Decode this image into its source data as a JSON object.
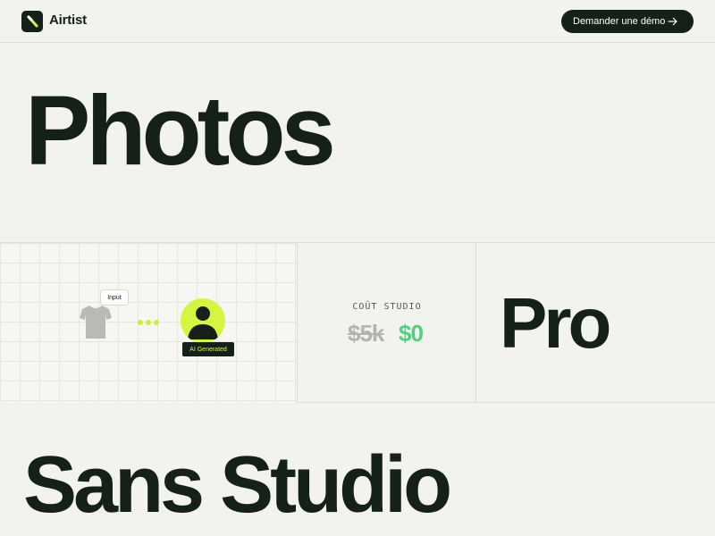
{
  "header": {
    "brand": "Airtist",
    "cta_label": "Demander une démo"
  },
  "hero": {
    "word_1": "Photos",
    "word_2": "Pro",
    "word_3": "Sans Studio"
  },
  "illustration": {
    "input_tag": "Input",
    "ai_badge": "AI Generated"
  },
  "cost": {
    "label": "COÛT STUDIO",
    "old_price": "$5k",
    "new_price": "$0"
  },
  "colors": {
    "background": "#f2f2ee",
    "ink": "#142018",
    "accent_lime": "#d5f53e",
    "accent_green": "#4cd47a"
  },
  "icons": {
    "logo": "magic-wand-icon",
    "cta": "arrow-right-icon",
    "input": "t-shirt-icon",
    "output": "person-avatar-icon"
  }
}
